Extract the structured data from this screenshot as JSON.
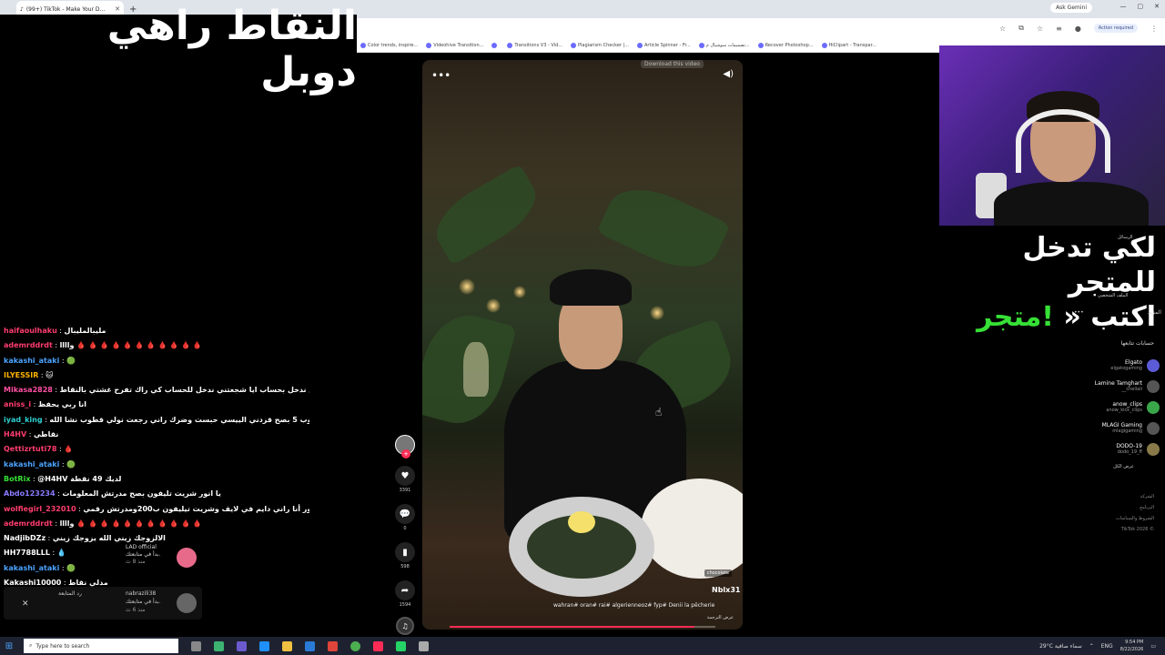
{
  "browser": {
    "tab_title": "(99+) TikTok - Make Your D...",
    "new_tab": "+",
    "ask_gemini": "Ask Gemini",
    "action_required": "Action required",
    "bookmarks": [
      "Color trends, inspire...",
      "Videohive Transition...",
      "",
      "Transitions V3 - Vid...",
      "Plagiarism Checker |...",
      "Article Spinner - Fr...",
      "تصميمات سوشيال م...",
      "Recover Photoshop...",
      "HiClipart - Transpar..."
    ]
  },
  "overlay_title": "النقاط راهي دوبل",
  "video": {
    "download_banner": "Download this video",
    "username": "Nblx31",
    "tag": "chocolate",
    "caption": "wahran# oran# rai# algerienneoz# fyp# Denii la pêcherie",
    "see_translation": "عرض الترجمة",
    "progress_fraction": 0.92
  },
  "rail": {
    "like_count": "3391",
    "comment_count": "0",
    "save_count": "598",
    "share_count": "1594"
  },
  "store_promo": {
    "line1": "لكي تدخل للمتجر",
    "line2_word": "اكتب",
    "arrows": "«",
    "line2_cmd": "!متجر"
  },
  "sidebar": {
    "messages": "الرسائل",
    "profile": "الملف الشخصي",
    "more": "المزيد",
    "following_title": "حسابات تتابعها",
    "following": [
      {
        "name": "Elgato",
        "handle": "elgatogaming"
      },
      {
        "name": "Lamine Tamghart",
        "handle": "__chellali"
      },
      {
        "name": "anow_clips",
        "handle": "anow_kick_clips"
      },
      {
        "name": "MLAGI Gaming",
        "handle": "mlagigaming"
      },
      {
        "name": "DODO-19",
        "handle": "dodo_19_ff"
      }
    ],
    "see_all": "عرض الكل",
    "footer": [
      "الشركة",
      "البرنامج",
      "الشروط والسياسات",
      "TikTok 2026 ©"
    ]
  },
  "chat": [
    {
      "user": "haifaoulhaku",
      "color": "#ff3d6e",
      "text": "مليبالمليبال"
    },
    {
      "user": "ademrddrdt",
      "color": "#ff3d6e",
      "text": "واااا 🩸 🩸 🩸 🩸 🩸 🩸 🩸 🩸 🩸 🩸 🩸"
    },
    {
      "user": "kakashi_ataki",
      "color": "#4aa3ff",
      "text": "🟢"
    },
    {
      "user": "ILYESSIR",
      "color": "#ffb300",
      "text": "🐱"
    },
    {
      "user": "Mikasa2828",
      "color": "#ff4fa3",
      "text": "ديما تتفرج عليك مي مكنتش ندخل بحساب ايا شجعتني ندخل للحساب كي راك تفرح غشتي بالنقاط"
    },
    {
      "user": "aniss_i",
      "color": "#ff3d6e",
      "text": "انا ربي يحفظ"
    },
    {
      "user": "iyad_king",
      "color": "#2fd0d0",
      "text": "نقطة والله والله والله كنت قطوب 5 بصح قزدني الييسي حبست وضرك راني رجعت نولي قطوب نشا الله"
    },
    {
      "user": "H4HV",
      "color": "#ff3d6e",
      "text": "نقاطي"
    },
    {
      "user": "Qettizrtuti78",
      "color": "#ff3d6e",
      "text": "🩸"
    },
    {
      "user": "kakashi_ataki",
      "color": "#4aa3ff",
      "text": "🟢"
    },
    {
      "user": "BotRix",
      "color": "#36e036",
      "text": "@H4HV لديك 49 نقطة"
    },
    {
      "user": "Abdo123234",
      "color": "#8a7bff",
      "text": "يا انور شريت تليفون بصح مدرتش المعلومات"
    },
    {
      "user": "wolfiegirl_232010",
      "color": "#ff3d6e",
      "text": "أنا انور أنا راني دايم في لايف وشريت تيليفون ب200ومدرتش رقمي ❤️ ❤️ ❤️"
    },
    {
      "user": "ademrddrdt",
      "color": "#ff3d6e",
      "text": "واااا 🩸 🩸 🩸 🩸 🩸 🩸 🩸 🩸 🩸 🩸 🩸"
    },
    {
      "user": "NadjibDZz",
      "color": "#fff",
      "text": "الالزوجك زيني الله يزوجك زيني"
    },
    {
      "user": "HH7788LLL",
      "color": "#fff",
      "text": "💧"
    },
    {
      "user": "kakashi_ataki",
      "color": "#4aa3ff",
      "text": "🟢"
    },
    {
      "user": "Kakashi10000",
      "color": "#fff",
      "text": "مدلي نقاط"
    }
  ],
  "notifications": [
    {
      "name": "LAD official",
      "text": "بدأ في متابعتك.",
      "time": "منذ 8 ث"
    },
    {
      "name": "nabrazili38",
      "text": "بدأ في متابعتك.",
      "time": "منذ 6 ث",
      "extra": "رد المتابعة"
    }
  ],
  "taskbar": {
    "search_placeholder": "Type here to search",
    "weather": "29°C  سماء صافية",
    "lang": "ENG",
    "time": "9:54 PM",
    "date": "8/22/2026"
  },
  "colors": {
    "tiktok_red": "#fe2c55",
    "promo_green": "#36e036",
    "webcam_purple": "#6a2fb6"
  }
}
